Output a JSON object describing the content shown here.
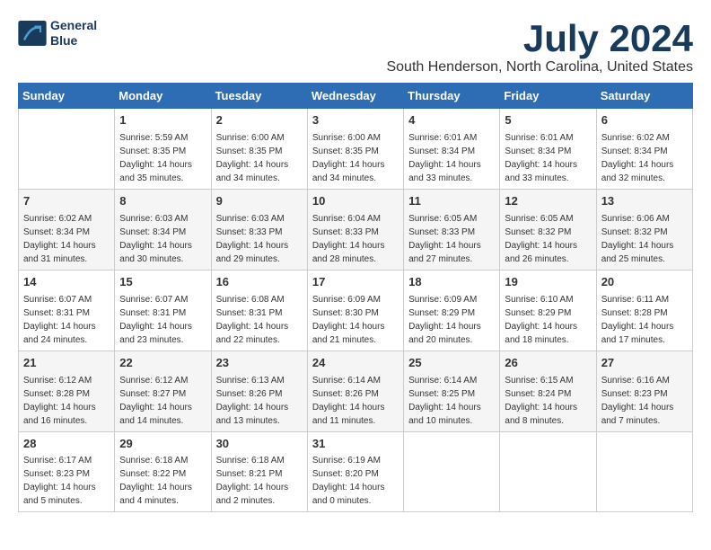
{
  "logo": {
    "line1": "General",
    "line2": "Blue"
  },
  "title": "July 2024",
  "subtitle": "South Henderson, North Carolina, United States",
  "days_of_week": [
    "Sunday",
    "Monday",
    "Tuesday",
    "Wednesday",
    "Thursday",
    "Friday",
    "Saturday"
  ],
  "weeks": [
    [
      {
        "day": "",
        "info": ""
      },
      {
        "day": "1",
        "info": "Sunrise: 5:59 AM\nSunset: 8:35 PM\nDaylight: 14 hours\nand 35 minutes."
      },
      {
        "day": "2",
        "info": "Sunrise: 6:00 AM\nSunset: 8:35 PM\nDaylight: 14 hours\nand 34 minutes."
      },
      {
        "day": "3",
        "info": "Sunrise: 6:00 AM\nSunset: 8:35 PM\nDaylight: 14 hours\nand 34 minutes."
      },
      {
        "day": "4",
        "info": "Sunrise: 6:01 AM\nSunset: 8:34 PM\nDaylight: 14 hours\nand 33 minutes."
      },
      {
        "day": "5",
        "info": "Sunrise: 6:01 AM\nSunset: 8:34 PM\nDaylight: 14 hours\nand 33 minutes."
      },
      {
        "day": "6",
        "info": "Sunrise: 6:02 AM\nSunset: 8:34 PM\nDaylight: 14 hours\nand 32 minutes."
      }
    ],
    [
      {
        "day": "7",
        "info": "Sunrise: 6:02 AM\nSunset: 8:34 PM\nDaylight: 14 hours\nand 31 minutes."
      },
      {
        "day": "8",
        "info": "Sunrise: 6:03 AM\nSunset: 8:34 PM\nDaylight: 14 hours\nand 30 minutes."
      },
      {
        "day": "9",
        "info": "Sunrise: 6:03 AM\nSunset: 8:33 PM\nDaylight: 14 hours\nand 29 minutes."
      },
      {
        "day": "10",
        "info": "Sunrise: 6:04 AM\nSunset: 8:33 PM\nDaylight: 14 hours\nand 28 minutes."
      },
      {
        "day": "11",
        "info": "Sunrise: 6:05 AM\nSunset: 8:33 PM\nDaylight: 14 hours\nand 27 minutes."
      },
      {
        "day": "12",
        "info": "Sunrise: 6:05 AM\nSunset: 8:32 PM\nDaylight: 14 hours\nand 26 minutes."
      },
      {
        "day": "13",
        "info": "Sunrise: 6:06 AM\nSunset: 8:32 PM\nDaylight: 14 hours\nand 25 minutes."
      }
    ],
    [
      {
        "day": "14",
        "info": "Sunrise: 6:07 AM\nSunset: 8:31 PM\nDaylight: 14 hours\nand 24 minutes."
      },
      {
        "day": "15",
        "info": "Sunrise: 6:07 AM\nSunset: 8:31 PM\nDaylight: 14 hours\nand 23 minutes."
      },
      {
        "day": "16",
        "info": "Sunrise: 6:08 AM\nSunset: 8:31 PM\nDaylight: 14 hours\nand 22 minutes."
      },
      {
        "day": "17",
        "info": "Sunrise: 6:09 AM\nSunset: 8:30 PM\nDaylight: 14 hours\nand 21 minutes."
      },
      {
        "day": "18",
        "info": "Sunrise: 6:09 AM\nSunset: 8:29 PM\nDaylight: 14 hours\nand 20 minutes."
      },
      {
        "day": "19",
        "info": "Sunrise: 6:10 AM\nSunset: 8:29 PM\nDaylight: 14 hours\nand 18 minutes."
      },
      {
        "day": "20",
        "info": "Sunrise: 6:11 AM\nSunset: 8:28 PM\nDaylight: 14 hours\nand 17 minutes."
      }
    ],
    [
      {
        "day": "21",
        "info": "Sunrise: 6:12 AM\nSunset: 8:28 PM\nDaylight: 14 hours\nand 16 minutes."
      },
      {
        "day": "22",
        "info": "Sunrise: 6:12 AM\nSunset: 8:27 PM\nDaylight: 14 hours\nand 14 minutes."
      },
      {
        "day": "23",
        "info": "Sunrise: 6:13 AM\nSunset: 8:26 PM\nDaylight: 14 hours\nand 13 minutes."
      },
      {
        "day": "24",
        "info": "Sunrise: 6:14 AM\nSunset: 8:26 PM\nDaylight: 14 hours\nand 11 minutes."
      },
      {
        "day": "25",
        "info": "Sunrise: 6:14 AM\nSunset: 8:25 PM\nDaylight: 14 hours\nand 10 minutes."
      },
      {
        "day": "26",
        "info": "Sunrise: 6:15 AM\nSunset: 8:24 PM\nDaylight: 14 hours\nand 8 minutes."
      },
      {
        "day": "27",
        "info": "Sunrise: 6:16 AM\nSunset: 8:23 PM\nDaylight: 14 hours\nand 7 minutes."
      }
    ],
    [
      {
        "day": "28",
        "info": "Sunrise: 6:17 AM\nSunset: 8:23 PM\nDaylight: 14 hours\nand 5 minutes."
      },
      {
        "day": "29",
        "info": "Sunrise: 6:18 AM\nSunset: 8:22 PM\nDaylight: 14 hours\nand 4 minutes."
      },
      {
        "day": "30",
        "info": "Sunrise: 6:18 AM\nSunset: 8:21 PM\nDaylight: 14 hours\nand 2 minutes."
      },
      {
        "day": "31",
        "info": "Sunrise: 6:19 AM\nSunset: 8:20 PM\nDaylight: 14 hours\nand 0 minutes."
      },
      {
        "day": "",
        "info": ""
      },
      {
        "day": "",
        "info": ""
      },
      {
        "day": "",
        "info": ""
      }
    ]
  ]
}
